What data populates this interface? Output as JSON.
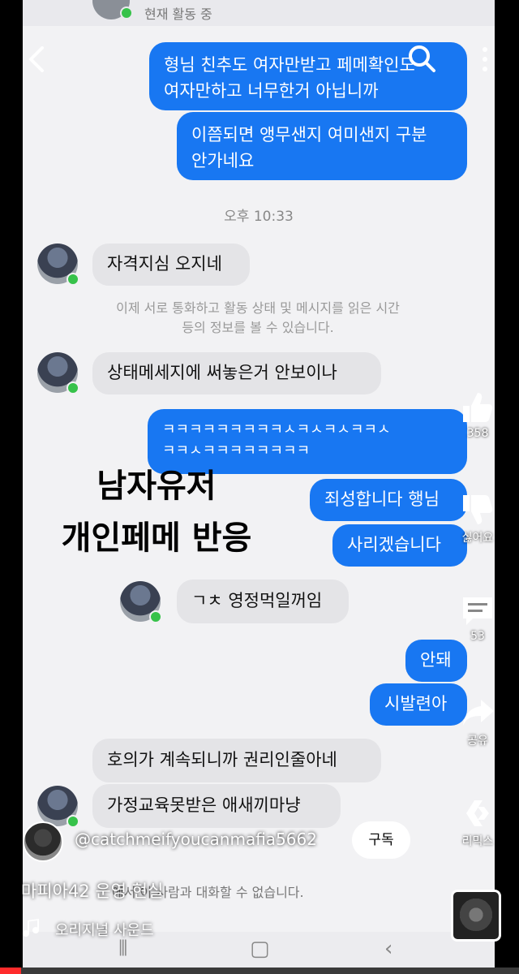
{
  "header": {
    "status": "현재 활동 중"
  },
  "messages": {
    "out1": "형님 친추도 여자만받고 페메확인도\n여자만하고 너무한거 아닙니까",
    "out2": "이쯤되면 앵무샌지 여미샌지 구분\n안가네요",
    "time": "오후 10:33",
    "in1": "자격지심 오지네",
    "notice": "이제 서로 통화하고 활동 상태 및 메시지를 읽은 시간\n등의 정보를 볼 수 있습니다.",
    "in2": "상태메세지에 써놓은거 안보이나",
    "out3": "ㅋㅋㅋㅋㅋㅋㅋㅋㅋㅅㅋㅅㅋㅅㅋㅋㅅ\nㅋㅋㅅㅋㅋㅋㅋㅋㅋㅋㅋ",
    "out4": "죄성합니다 행님",
    "out5": "사리겠습니다",
    "in3": "ㄱㅊ 영정먹일꺼임",
    "out6": "안돼",
    "out7": "시발련아",
    "in4": "호의가 계속되니까 권리인줄아네",
    "in5": "가정교육못받은 애새끼마냥",
    "blocked": "에서 이 사람과 대화할 수 없습니다."
  },
  "overlay_caption": {
    "line1": "남자유저",
    "line2": "개인페메 반응"
  },
  "actions": {
    "like_count": "358",
    "dislike_label": "싫어요",
    "comment_count": "53",
    "share_label": "공유",
    "remix_label": "리믹스"
  },
  "channel": {
    "name": "@catchmeifyoucanmafia5662",
    "subscribe_label": "구독"
  },
  "video": {
    "title": "마피아42 운영 현실",
    "sound_label": "오리지널 사운드",
    "progress_fraction": 0.04
  },
  "colors": {
    "outgoing_bubble": "#1877f2",
    "incoming_bubble": "#e4e4e7",
    "progress": "#ff2b2b"
  }
}
